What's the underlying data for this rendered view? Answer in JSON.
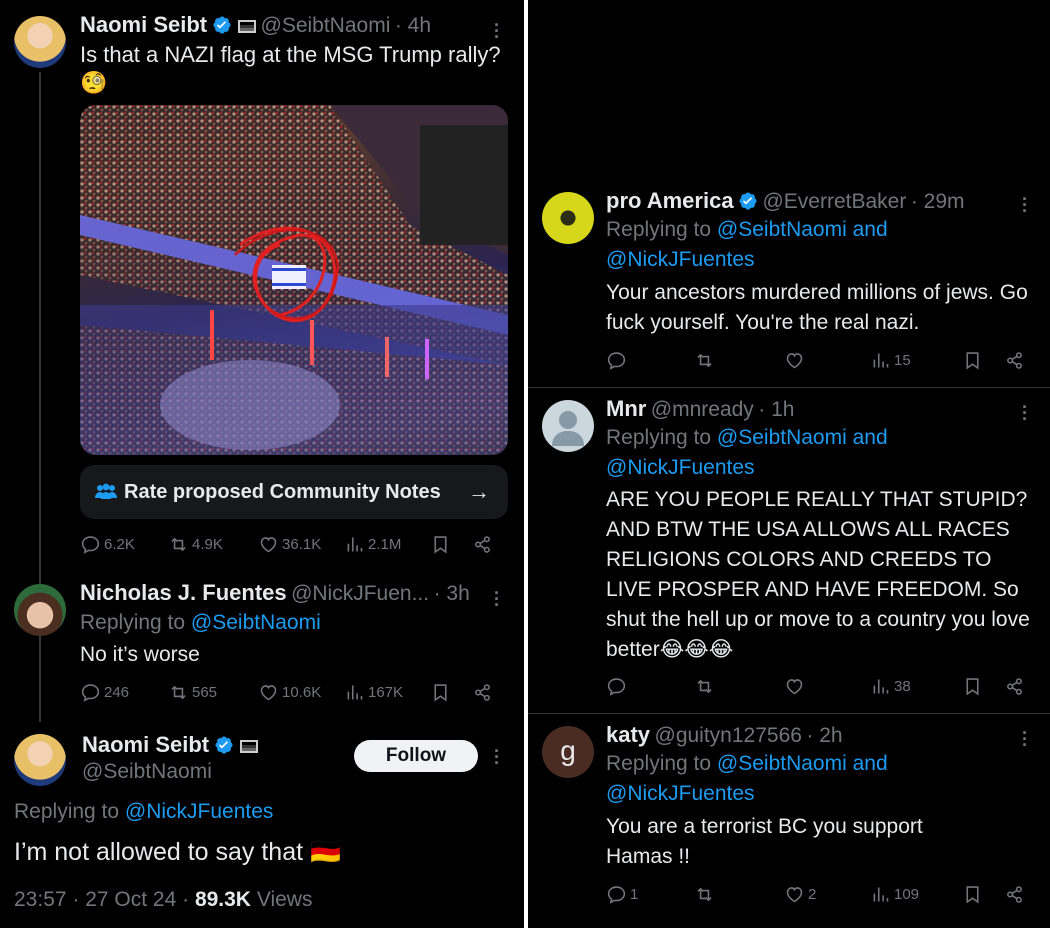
{
  "left": {
    "tweet1": {
      "name": "Naomi Seibt",
      "handle": "@SeibtNaomi",
      "time": "· 4h",
      "text": "Is that a NAZI flag at the MSG Trump rally?",
      "emoji": "🧐",
      "community_notes": "Rate proposed Community Notes",
      "replies": "6.2K",
      "retweets": "4.9K",
      "likes": "36.1K",
      "views": "2.1M"
    },
    "tweet2": {
      "name": "Nicholas J. Fuentes",
      "handle": "@NickJFuen...",
      "time": "· 3h",
      "replying_prefix": "Replying to",
      "replying_to": "@SeibtNaomi",
      "text": "No it’s worse",
      "replies": "246",
      "retweets": "565",
      "likes": "10.6K",
      "views": "167K"
    },
    "main": {
      "name": "Naomi Seibt",
      "handle": "@SeibtNaomi",
      "follow": "Follow",
      "replying_prefix": "Replying to",
      "replying_to": "@NickJFuentes",
      "text": "I’m not allowed to say that 🇩🇪",
      "timestamp": "23:57 · 27 Oct 24 · ",
      "views_count": "89.3K",
      "views_label": " Views"
    }
  },
  "right": {
    "reply1": {
      "name": "pro America",
      "handle": "@EverretBaker",
      "time": "· 29m",
      "replying_prefix": "Replying to",
      "replying_to_1": "@SeibtNaomi and",
      "replying_to_2": "@NickJFuentes",
      "text": "Your ancestors murdered millions of jews. Go fuck yourself. You're the real nazi.",
      "replies": "",
      "retweets": "",
      "likes": "",
      "views": "15"
    },
    "reply2": {
      "name": "Mnr",
      "handle": "@mnready",
      "time": "· 1h",
      "replying_prefix": "Replying to",
      "replying_to_1": "@SeibtNaomi and",
      "replying_to_2": "@NickJFuentes",
      "text": "ARE YOU PEOPLE REALLY THAT STUPID? AND BTW THE USA ALLOWS ALL RACES RELIGIONS COLORS AND CREEDS TO LIVE PROSPER AND HAVE FREEDOM. So shut the hell up or move to a country you love better😂😂😂",
      "views": "38"
    },
    "reply3": {
      "name": "katy",
      "handle": "@guityn127566",
      "time": "· 2h",
      "avatar_letter": "g",
      "replying_prefix": "Replying to",
      "replying_to_1": "@SeibtNaomi and",
      "replying_to_2": "@NickJFuentes",
      "text": "You are a terrorist BC you support Hamas !!",
      "replies": "1",
      "likes": "2",
      "views": "109"
    }
  },
  "colors": {
    "background": "#000000",
    "text": "#e7e9ea",
    "muted": "#71767b",
    "link": "#1d9bf0",
    "verified": "#1d9bf0"
  }
}
